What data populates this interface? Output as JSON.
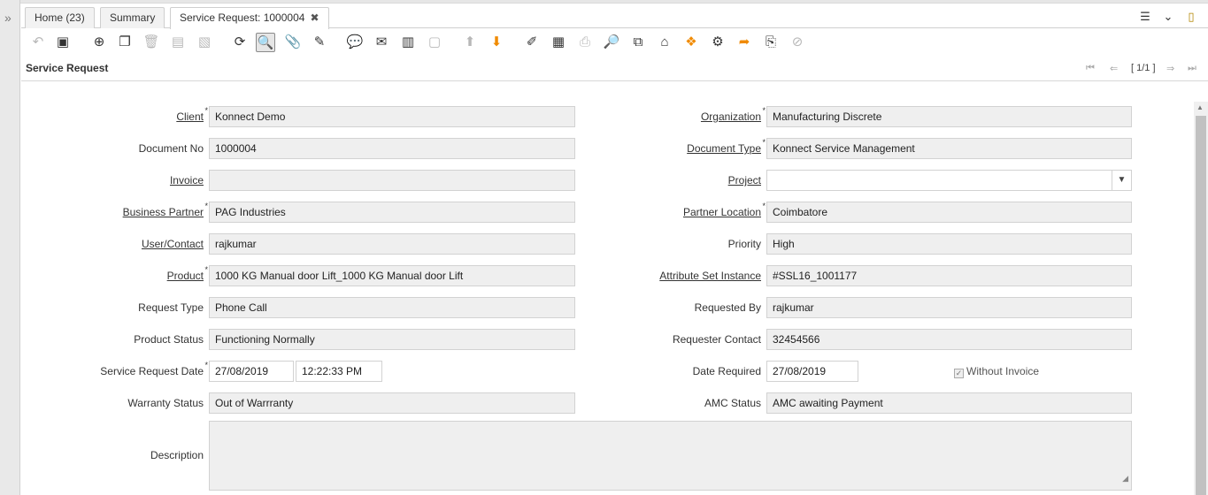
{
  "tabs": [
    {
      "label": "Home (23)"
    },
    {
      "label": "Summary"
    },
    {
      "label": "Service Request: 1000004"
    }
  ],
  "tab_close_glyph": "✖",
  "window_title": "Service Request",
  "navigation": {
    "record_indicator": "[ 1/1 ]"
  },
  "fields": {
    "client": {
      "label": "Client",
      "value": "Konnect Demo"
    },
    "document_no": {
      "label": "Document No",
      "value": "1000004"
    },
    "invoice": {
      "label": "Invoice",
      "value": ""
    },
    "business_partner": {
      "label": "Business Partner ",
      "value": "PAG Industries"
    },
    "user_contact": {
      "label": "User/Contact",
      "value": "rajkumar"
    },
    "product": {
      "label": "Product",
      "value": "1000 KG Manual door Lift_1000 KG Manual door Lift"
    },
    "request_type": {
      "label": "Request Type",
      "value": "Phone Call"
    },
    "product_status": {
      "label": "Product Status",
      "value": "Functioning Normally"
    },
    "service_request_date": {
      "label": "Service Request Date",
      "date": "27/08/2019",
      "time": "12:22:33 PM"
    },
    "warranty_status": {
      "label": "Warranty Status",
      "value": "Out of Warrranty"
    },
    "description": {
      "label": "Description",
      "value": ""
    },
    "organization": {
      "label": "Organization",
      "value": "Manufacturing Discrete"
    },
    "document_type": {
      "label": "Document Type",
      "value": "Konnect Service Management"
    },
    "project": {
      "label": "Project",
      "value": ""
    },
    "partner_location": {
      "label": "Partner Location",
      "value": "Coimbatore"
    },
    "priority": {
      "label": "Priority",
      "value": "High"
    },
    "attribute_set_instance": {
      "label": "Attribute Set Instance",
      "value": "#SSL16_1001177"
    },
    "requested_by": {
      "label": "Requested By",
      "value": "rajkumar"
    },
    "requester_contact": {
      "label": "Requester Contact",
      "value": "32454566"
    },
    "date_required": {
      "label": "Date Required",
      "value": "27/08/2019"
    },
    "without_invoice": {
      "label": "Without Invoice",
      "checked": true
    },
    "amc_status": {
      "label": "AMC Status",
      "value": "AMC awaiting Payment"
    }
  },
  "colors": {
    "accent_orange": "#f08a00",
    "toolbar_dark": "#4a4a4a"
  }
}
